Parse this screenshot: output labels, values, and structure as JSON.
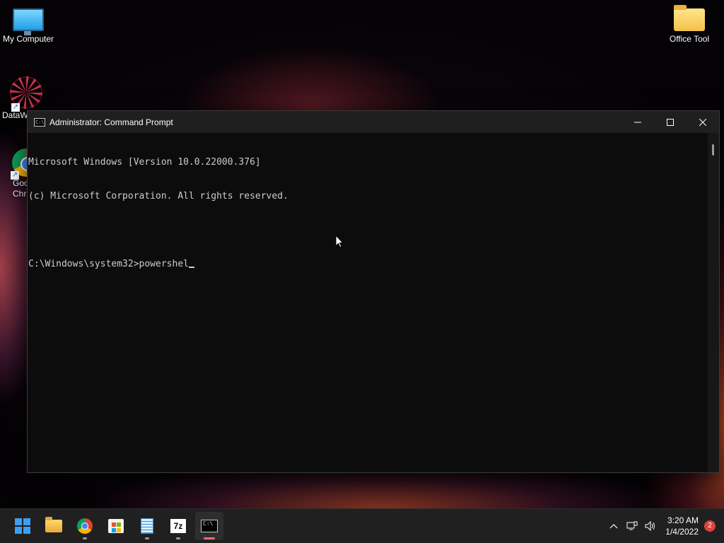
{
  "desktop": {
    "icons": [
      {
        "label": "My Computer"
      },
      {
        "label": "DataW"
      },
      {
        "label": "Goo\nChro"
      },
      {
        "label": "Office Tool"
      }
    ]
  },
  "window": {
    "title": "Administrator: Command Prompt",
    "console_lines": [
      "Microsoft Windows [Version 10.0.22000.376]",
      "(c) Microsoft Corporation. All rights reserved.",
      "",
      "C:\\Windows\\system32>powershel"
    ]
  },
  "taskbar": {
    "apps": [
      "start",
      "file-explorer",
      "chrome",
      "microsoft-store",
      "notepad",
      "7zip",
      "command-prompt"
    ],
    "sevenzip_label": "7z",
    "cmd_icon_text": "C:\\",
    "clock_time": "3:20 AM",
    "clock_date": "1/4/2022",
    "notification_count": "2"
  },
  "colors": {
    "accent_indicator": "#e0726e",
    "console_text": "#cccccc",
    "console_bg": "#0c0c0c"
  }
}
